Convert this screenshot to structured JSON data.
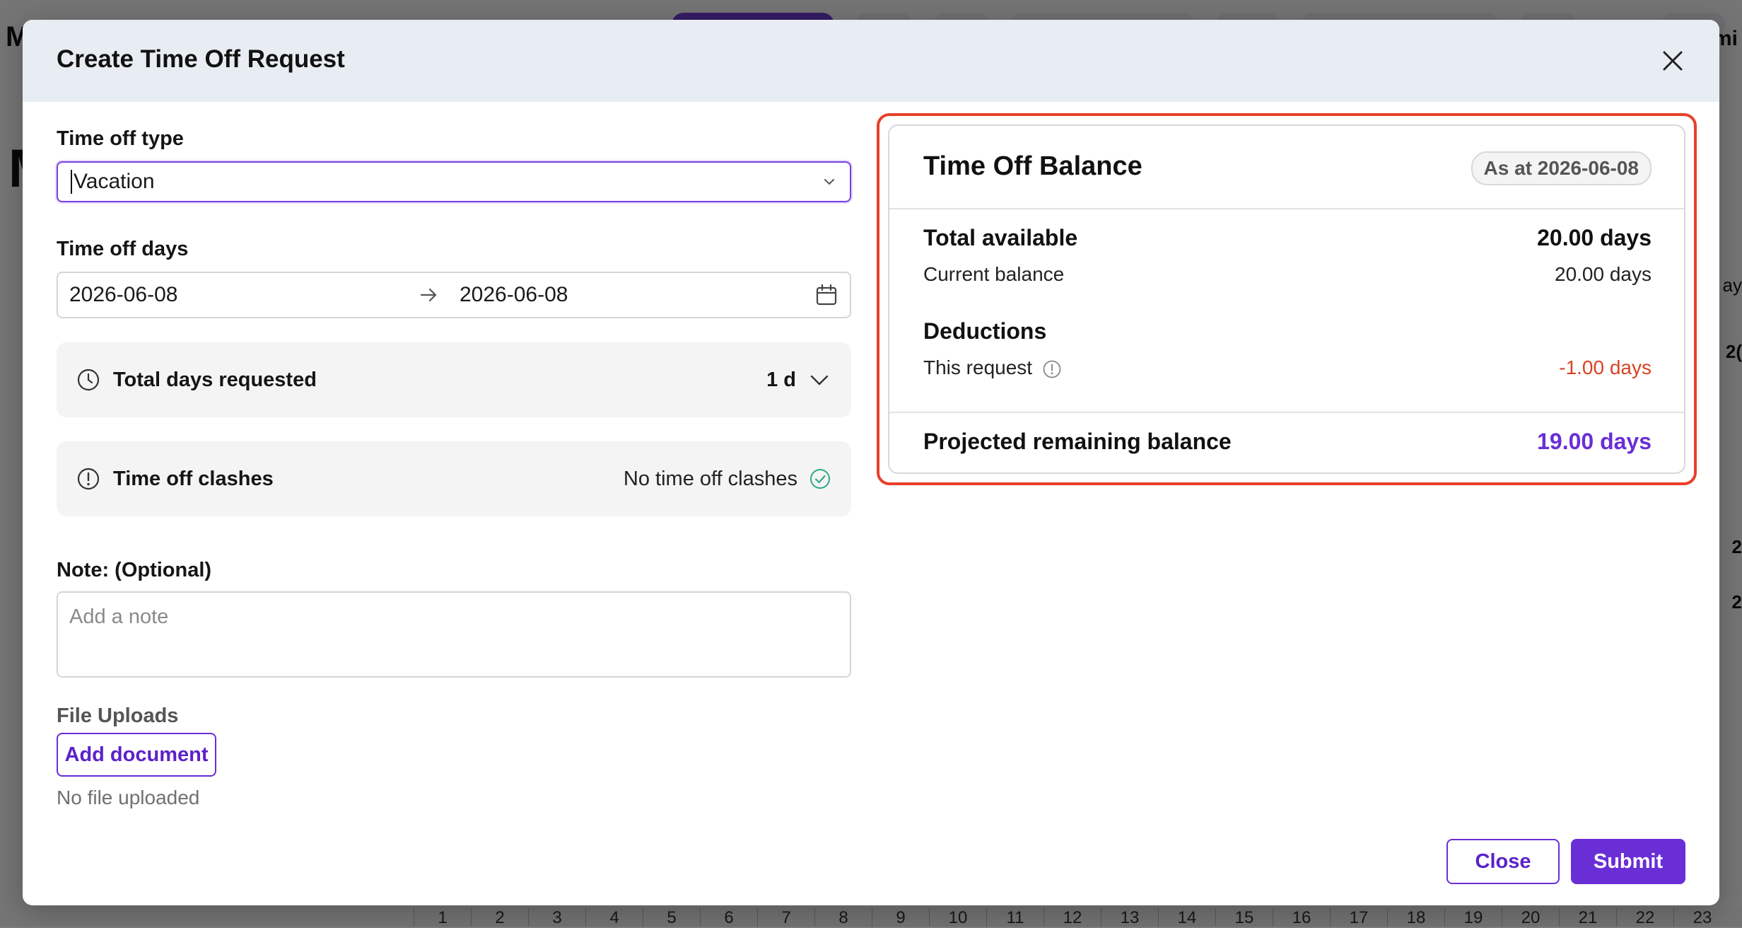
{
  "modal": {
    "title": "Create Time Off Request"
  },
  "form": {
    "time_off_type": {
      "label": "Time off type",
      "value": "Vacation"
    },
    "time_off_days": {
      "label": "Time off days",
      "start": "2026-06-08",
      "end": "2026-06-08"
    },
    "total_days": {
      "label": "Total days requested",
      "value": "1 d"
    },
    "clashes": {
      "label": "Time off clashes",
      "value": "No time off clashes"
    },
    "note": {
      "label": "Note: (Optional)",
      "placeholder": "Add a note"
    },
    "uploads": {
      "label": "File Uploads",
      "button": "Add document",
      "status": "No file uploaded"
    }
  },
  "balance": {
    "title": "Time Off Balance",
    "as_at": "As at 2026-06-08",
    "total_available_label": "Total available",
    "total_available_value": "20.00 days",
    "current_balance_label": "Current balance",
    "current_balance_value": "20.00 days",
    "deductions_label": "Deductions",
    "this_request_label": "This request",
    "this_request_value": "-1.00 days",
    "projected_label": "Projected remaining balance",
    "projected_value": "19.00 days"
  },
  "footer": {
    "close": "Close",
    "submit": "Submit"
  },
  "background": {
    "left_letter": "M",
    "big_letter": "M",
    "right_text": "mi",
    "right_cells": [
      "ay",
      "2(",
      "2",
      "2"
    ],
    "calendar_days": [
      "1",
      "2",
      "3",
      "4",
      "5",
      "6",
      "7",
      "8",
      "9",
      "10",
      "11",
      "12",
      "13",
      "14",
      "15",
      "16",
      "17",
      "18",
      "19",
      "20",
      "21",
      "22",
      "23"
    ]
  },
  "colors": {
    "accent": "#6a2ed6",
    "negative": "#d84325",
    "highlight": "#e8402a",
    "success": "#2fa884",
    "header_bg": "#e8edf3"
  },
  "icons": {
    "close": "close-icon",
    "dropdown": "chevron-down-icon",
    "arrow": "arrow-right-icon",
    "calendar": "calendar-icon",
    "clock": "clock-icon",
    "alert": "alert-circle-icon",
    "check": "check-circle-icon",
    "info": "info-icon"
  }
}
